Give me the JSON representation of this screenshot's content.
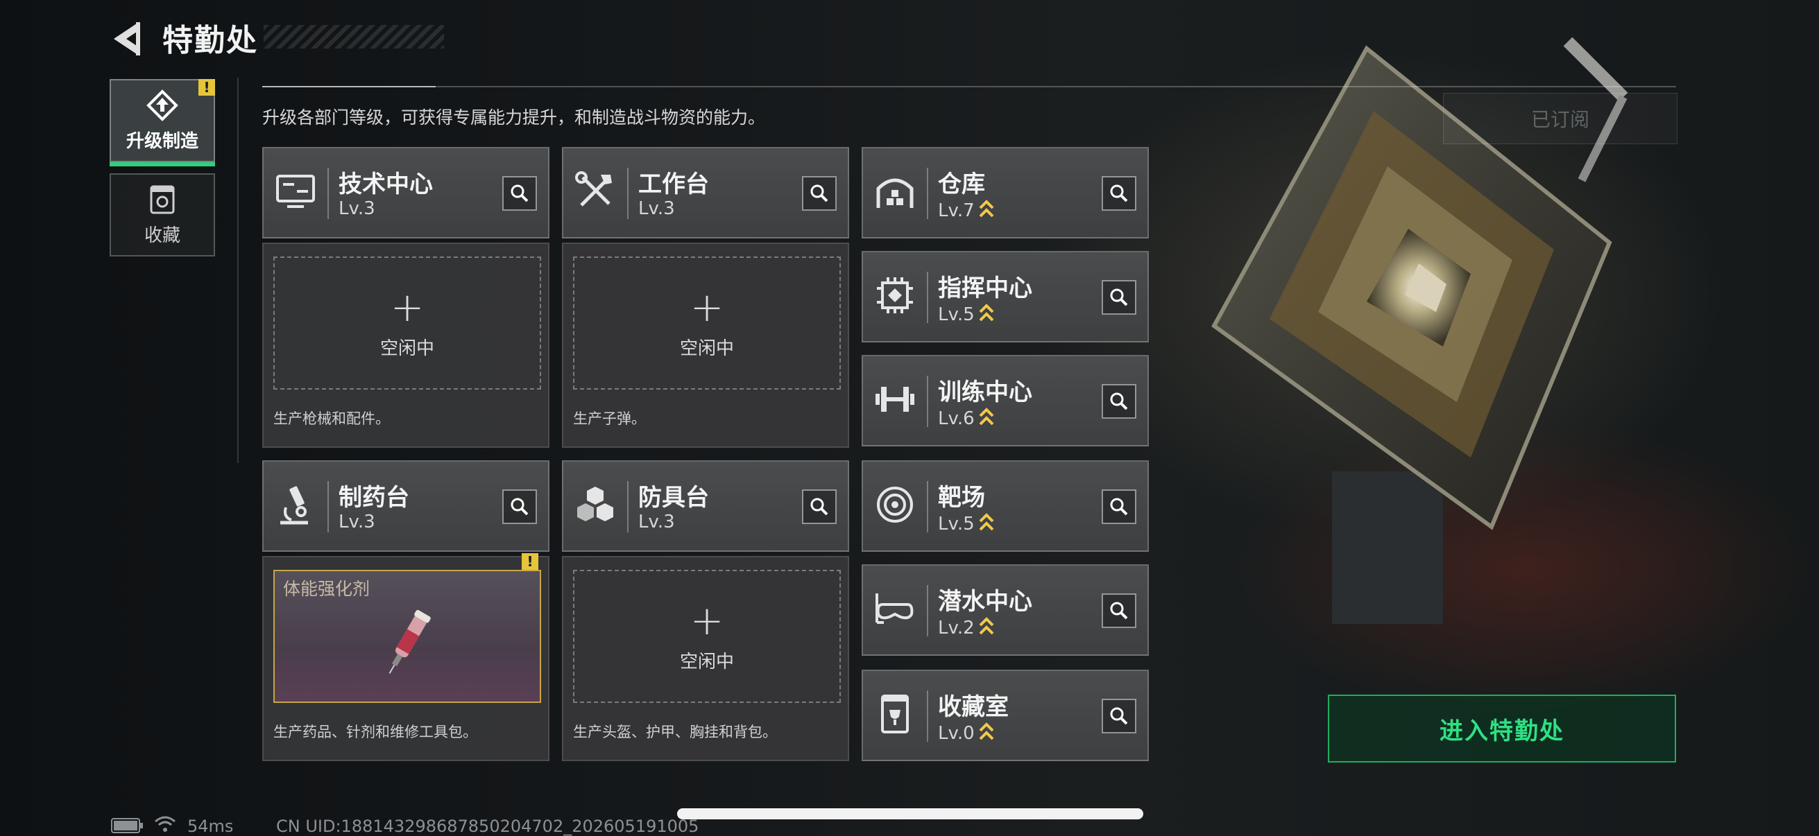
{
  "header": {
    "title": "特勤处",
    "subtitle": "升级各部门等级，可获得专属能力提升，和制造战斗物资的能力。",
    "subscribed_label": "已订阅"
  },
  "sidebar": {
    "items": [
      {
        "label": "升级制造",
        "icon": "upgrade-build-icon",
        "active": true,
        "alert": "!"
      },
      {
        "label": "收藏",
        "icon": "collection-icon",
        "active": false
      }
    ]
  },
  "departments": {
    "tech": {
      "name": "技术中心",
      "level": "Lv.3",
      "icon": "monitor-icon",
      "idle": "空闲中",
      "plus": "+",
      "desc": "生产枪械和配件。"
    },
    "workbench": {
      "name": "工作台",
      "level": "Lv.3",
      "icon": "tools-icon",
      "idle": "空闲中",
      "plus": "+",
      "desc": "生产子弹。"
    },
    "pharmacy": {
      "name": "制药台",
      "level": "Lv.3",
      "icon": "microscope-icon",
      "item_name": "体能强化剂",
      "alert": "!",
      "desc": "生产药品、针剂和维修工具包。"
    },
    "armor": {
      "name": "防具台",
      "level": "Lv.3",
      "icon": "armor-blocks-icon",
      "idle": "空闲中",
      "plus": "+",
      "desc": "生产头盔、护甲、胸挂和背包。"
    },
    "warehouse": {
      "name": "仓库",
      "level": "Lv.7",
      "icon": "warehouse-icon"
    },
    "command": {
      "name": "指挥中心",
      "level": "Lv.5",
      "icon": "chip-icon"
    },
    "training": {
      "name": "训练中心",
      "level": "Lv.6",
      "icon": "dumbbell-icon"
    },
    "range": {
      "name": "靶场",
      "level": "Lv.5",
      "icon": "target-icon"
    },
    "diving": {
      "name": "潜水中心",
      "level": "Lv.2",
      "icon": "diving-mask-icon"
    },
    "collection": {
      "name": "收藏室",
      "level": "Lv.0",
      "icon": "trophy-case-icon"
    }
  },
  "enter_button": {
    "label": "进入特勤处"
  },
  "status_bar": {
    "ping": "54ms",
    "uid": "CN UID:18814329868785020470​2_202605191005"
  },
  "colors": {
    "accent_green": "#2fe083",
    "gold": "#e6c53a",
    "upgrade_chevron": "#f2c94c"
  }
}
